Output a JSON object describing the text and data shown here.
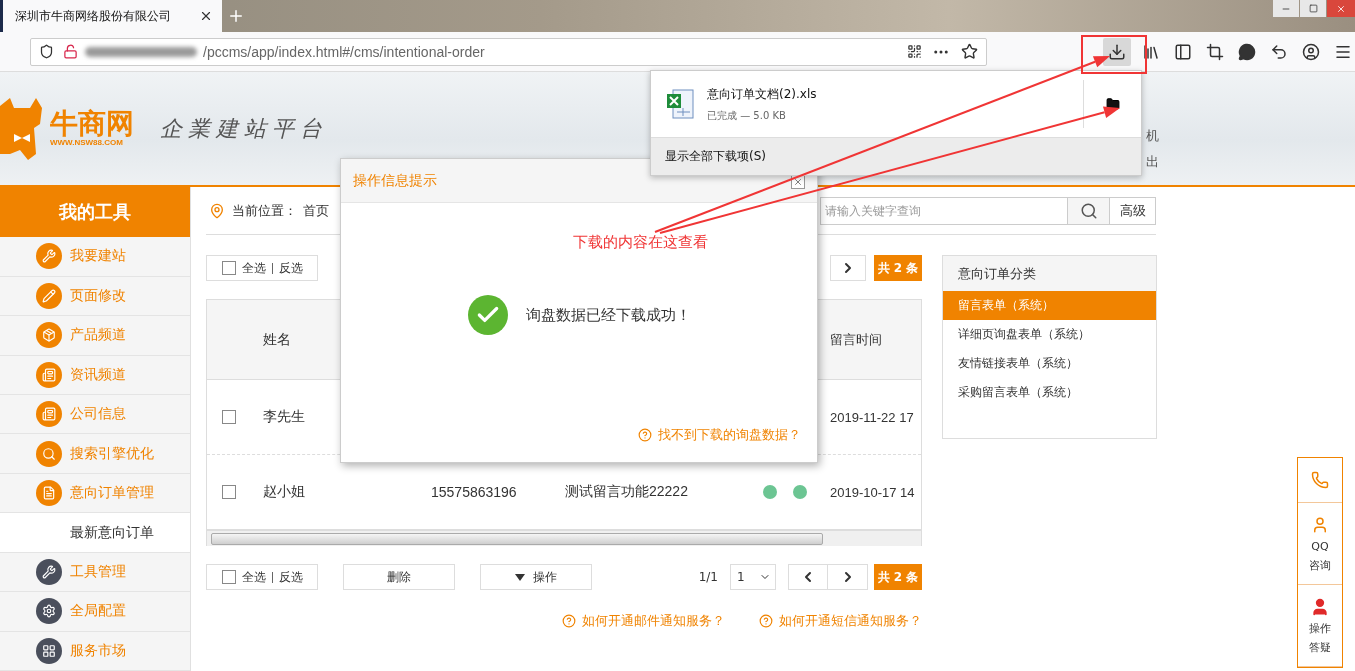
{
  "browser": {
    "tab_title": "深圳市牛商网络股份有限公司",
    "url": "/pccms/app/index.html#/cms/intentional-order"
  },
  "downloads": {
    "files": [
      {
        "name": "意向订单文档(2).xls",
        "status": "已完成 — 5.0 KB"
      }
    ],
    "show_all": "显示全部下载项(S)"
  },
  "header": {
    "brand": "牛商网",
    "domain": "WWW.NSW88.COM",
    "slogan": "企業建站平台",
    "links": [
      "机",
      "出"
    ]
  },
  "sidebar": {
    "title": "我的工具",
    "items": [
      {
        "label": "我要建站",
        "color": "#f08300"
      },
      {
        "label": "页面修改",
        "color": "#f08300"
      },
      {
        "label": "产品频道",
        "color": "#f08300"
      },
      {
        "label": "资讯频道",
        "color": "#f08300"
      },
      {
        "label": "公司信息",
        "color": "#f08300"
      },
      {
        "label": "搜索引擎优化",
        "color": "#f08300"
      },
      {
        "label": "意向订单管理",
        "color": "#f08300",
        "children": [
          {
            "label": "最新意向订单",
            "selected": true
          }
        ]
      },
      {
        "label": "工具管理",
        "color": "#4a4f5c"
      },
      {
        "label": "全局配置",
        "color": "#4a4f5c"
      },
      {
        "label": "服务市场",
        "color": "#4a4f5c"
      }
    ]
  },
  "breadcrumb": {
    "label": "当前位置：",
    "current": "首页"
  },
  "search": {
    "placeholder": "请输入关键字查询",
    "advanced": "高级"
  },
  "top_toolbar": {
    "select_all": "全选",
    "invert": "反选",
    "checked": false,
    "total": "共 2 条"
  },
  "table": {
    "headers": {
      "name": "姓名",
      "time": "留言时间"
    },
    "rows": [
      {
        "checked": false,
        "name": "李先生",
        "time": "2019-11-22 17"
      },
      {
        "checked": false,
        "name": "赵小姐",
        "phone": "15575863196",
        "message": "测试留言功能22222",
        "dots": [
          {
            "color": "#6cc593"
          },
          {
            "color": "#6cc593"
          }
        ],
        "time": "2019-10-17 14"
      }
    ]
  },
  "bottom_toolbar": {
    "select_all": "全选",
    "invert": "反选",
    "checked": false,
    "delete": "删除",
    "action": "操作",
    "page_info": "1/1",
    "page_value": "1",
    "total": "共 2 条"
  },
  "help_links": [
    "如何开通邮件通知服务？",
    "如何开通短信通知服务？"
  ],
  "categories": {
    "title": "意向订单分类",
    "items": [
      {
        "label": "留言表单（系统）",
        "selected": true
      },
      {
        "label": "详细页询盘表单（系统）",
        "selected": false
      },
      {
        "label": "友情链接表单（系统）",
        "selected": false
      },
      {
        "label": "采购留言表单（系统）",
        "selected": false
      }
    ]
  },
  "float_bar": {
    "items": [
      {
        "kind": "phone"
      },
      {
        "kind": "qq",
        "lines": [
          "QQ",
          "咨询"
        ]
      },
      {
        "kind": "help",
        "lines": [
          "操作",
          "答疑"
        ]
      }
    ]
  },
  "modal": {
    "title": "操作信息提示",
    "message": "询盘数据已经下载成功！",
    "help": "找不到下载的询盘数据？"
  },
  "annotation": {
    "text": "下载的内容在这查看"
  }
}
